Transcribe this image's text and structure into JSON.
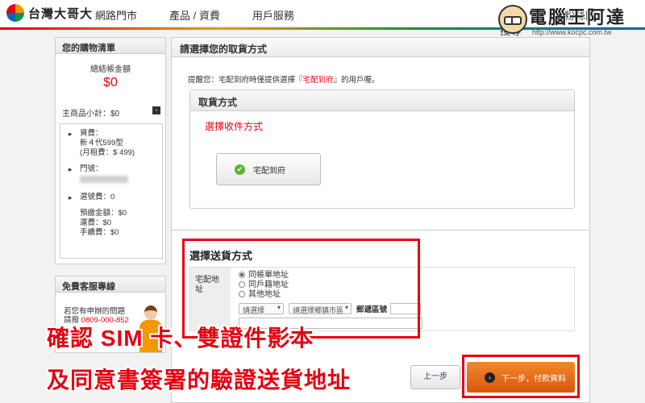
{
  "header": {
    "logo_text": "台灣大哥大",
    "nav": [
      "網路門市",
      "產品 / 資費",
      "用戶服務"
    ],
    "nav_right": [
      "找門",
      "粉絲團",
      "搜尋"
    ],
    "watermark_title": "電腦王阿達",
    "watermark_url": "http://www.kocpc.com.tw"
  },
  "sidebar": {
    "cart_title": "您的購物清單",
    "total_label": "總結帳金額",
    "total_value": "$0",
    "subtotal_label": "主商品小計：$0",
    "collapse_symbol": "-",
    "plan_label": "資費：",
    "plan_name": "新４代599型",
    "plan_fee": "(月租費：$ 499)",
    "number_label": "門號：",
    "selection_fee": "選號費：0",
    "prepay": "預繳金額：$0",
    "shipping_fee": "運費：$0",
    "handling_fee": "手續費：$0",
    "service_title": "免費客服專線",
    "service_line1": "若您有申辦的問題",
    "service_line2": "請撥",
    "service_phone": "0809-000-852"
  },
  "main": {
    "title": "請選擇您的取貨方式",
    "notice_prefix": "提醒您：宅配到府時僅提供選擇『",
    "notice_highlight": "宅配到府",
    "notice_suffix": "』的用戶喔。",
    "pickup_title": "取貨方式",
    "pickup_subtitle": "選擇收件方式",
    "home_delivery_label": "宅配到府",
    "shipping_title": "選擇送貨方式",
    "address_label": "宅配地址",
    "options": [
      "同帳單地址",
      "同戶籍地址",
      "其他地址"
    ],
    "city_placeholder": "請選擇",
    "district_placeholder": "請選擇鄉鎮市區",
    "zip_label": "郵遞區號",
    "prev_label": "上一步",
    "next_label": "下一步，付款資料"
  },
  "captions": {
    "line1": "確認 SIM 卡、雙證件影本",
    "line2": "及同意書簽署的驗證送貨地址"
  },
  "colors": {
    "accent_red": "#e60012",
    "button_orange": "#f08a2a",
    "check_green": "#5cb531"
  }
}
